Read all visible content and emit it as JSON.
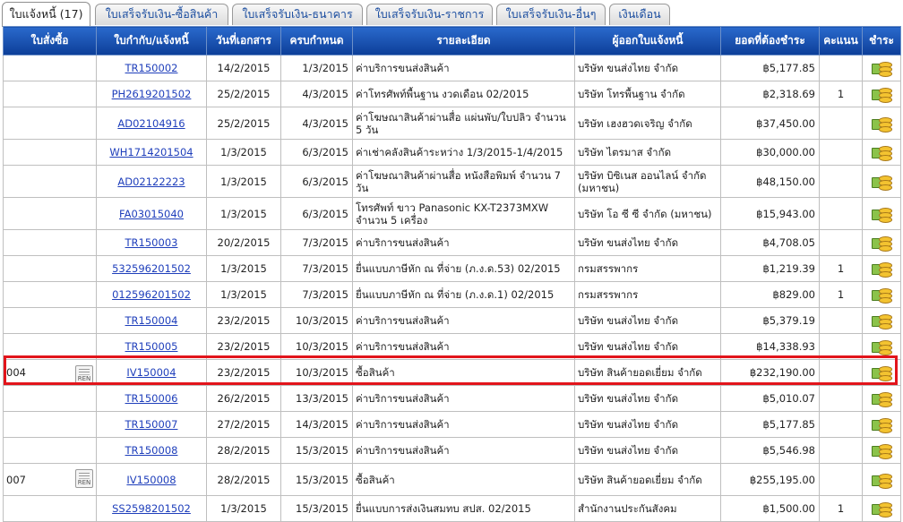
{
  "tabs": [
    {
      "label": "ใบแจ้งหนี้ (17)",
      "active": true
    },
    {
      "label": "ใบเสร็จรับเงิน-ซื้อสินค้า",
      "active": false
    },
    {
      "label": "ใบเสร็จรับเงิน-ธนาคาร",
      "active": false
    },
    {
      "label": "ใบเสร็จรับเงิน-ราชการ",
      "active": false
    },
    {
      "label": "ใบเสร็จรับเงิน-อื่นๆ",
      "active": false
    },
    {
      "label": "เงินเดือน",
      "active": false
    }
  ],
  "columns": [
    "ใบสั่งซื้อ",
    "ใบกำกับ/แจ้งหนี้",
    "วันที่เอกสาร",
    "ครบกำหนด",
    "รายละเอียด",
    "ผู้ออกใบแจ้งหนี้",
    "ยอดที่ต้องชำระ",
    "คะแนน",
    "ชำระ"
  ],
  "attachment_label": "REN",
  "pay_icon": "money-coins-icon",
  "highlight_color": "#e2141b",
  "rows": [
    {
      "order": "",
      "ref": "TR150002",
      "doc_date": "14/2/2015",
      "due": "1/3/2015",
      "detail": "ค่าบริการขนส่งสินค้า",
      "issuer": "บริษัท ขนส่งไทย จำกัด",
      "amount": "฿5,177.85",
      "score": ""
    },
    {
      "order": "",
      "ref": "PH2619201502",
      "doc_date": "25/2/2015",
      "due": "4/3/2015",
      "detail": "ค่าโทรศัพท์พื้นฐาน งวดเดือน 02/2015",
      "issuer": "บริษัท โทรพื้นฐาน จำกัด",
      "amount": "฿2,318.69",
      "score": "1"
    },
    {
      "order": "",
      "ref": "AD02104916",
      "doc_date": "25/2/2015",
      "due": "4/3/2015",
      "detail": "ค่าโฆษณาสินค้าผ่านสื่อ แผ่นพับ/ใบปลิว จำนวน 5 วัน",
      "issuer": "บริษัท เฮงฮวดเจริญ จำกัด",
      "amount": "฿37,450.00",
      "score": ""
    },
    {
      "order": "",
      "ref": "WH1714201504",
      "doc_date": "1/3/2015",
      "due": "6/3/2015",
      "detail": "ค่าเช่าคลังสินค้าระหว่าง 1/3/2015-1/4/2015",
      "issuer": "บริษัท ไตรมาส จำกัด",
      "amount": "฿30,000.00",
      "score": ""
    },
    {
      "order": "",
      "ref": "AD02122223",
      "doc_date": "1/3/2015",
      "due": "6/3/2015",
      "detail": "ค่าโฆษณาสินค้าผ่านสื่อ หนังสือพิมพ์ จำนวน 7 วัน",
      "issuer": "บริษัท บิซิเนส ออนไลน์ จำกัด (มหาชน)",
      "amount": "฿48,150.00",
      "score": ""
    },
    {
      "order": "",
      "ref": "FA03015040",
      "doc_date": "1/3/2015",
      "due": "6/3/2015",
      "detail": "โทรศัพท์ ขาว Panasonic KX-T2373MXW จำนวน 5 เครื่อง",
      "issuer": "บริษัท โอ ซี ซี จำกัด (มหาชน)",
      "amount": "฿15,943.00",
      "score": ""
    },
    {
      "order": "",
      "ref": "TR150003",
      "doc_date": "20/2/2015",
      "due": "7/3/2015",
      "detail": "ค่าบริการขนส่งสินค้า",
      "issuer": "บริษัท ขนส่งไทย จำกัด",
      "amount": "฿4,708.05",
      "score": ""
    },
    {
      "order": "",
      "ref": "532596201502",
      "doc_date": "1/3/2015",
      "due": "7/3/2015",
      "detail": "ยื่นแบบภาษีหัก ณ ที่จ่าย (ภ.ง.ด.53) 02/2015",
      "issuer": "กรมสรรพากร",
      "amount": "฿1,219.39",
      "score": "1"
    },
    {
      "order": "",
      "ref": "012596201502",
      "doc_date": "1/3/2015",
      "due": "7/3/2015",
      "detail": "ยื่นแบบภาษีหัก ณ ที่จ่าย (ภ.ง.ด.1) 02/2015",
      "issuer": "กรมสรรพากร",
      "amount": "฿829.00",
      "score": "1"
    },
    {
      "order": "",
      "ref": "TR150004",
      "doc_date": "23/2/2015",
      "due": "10/3/2015",
      "detail": "ค่าบริการขนส่งสินค้า",
      "issuer": "บริษัท ขนส่งไทย จำกัด",
      "amount": "฿5,379.19",
      "score": ""
    },
    {
      "order": "",
      "ref": "TR150005",
      "doc_date": "23/2/2015",
      "due": "10/3/2015",
      "detail": "ค่าบริการขนส่งสินค้า",
      "issuer": "บริษัท ขนส่งไทย จำกัด",
      "amount": "฿14,338.93",
      "score": ""
    },
    {
      "order": "004",
      "ref": "IV150004",
      "doc_date": "23/2/2015",
      "due": "10/3/2015",
      "detail": "ซื้อสินค้า",
      "issuer": "บริษัท สินค้ายอดเยี่ยม จำกัด",
      "amount": "฿232,190.00",
      "score": "",
      "highlighted": true
    },
    {
      "order": "",
      "ref": "TR150006",
      "doc_date": "26/2/2015",
      "due": "13/3/2015",
      "detail": "ค่าบริการขนส่งสินค้า",
      "issuer": "บริษัท ขนส่งไทย จำกัด",
      "amount": "฿5,010.07",
      "score": ""
    },
    {
      "order": "",
      "ref": "TR150007",
      "doc_date": "27/2/2015",
      "due": "14/3/2015",
      "detail": "ค่าบริการขนส่งสินค้า",
      "issuer": "บริษัท ขนส่งไทย จำกัด",
      "amount": "฿5,177.85",
      "score": ""
    },
    {
      "order": "",
      "ref": "TR150008",
      "doc_date": "28/2/2015",
      "due": "15/3/2015",
      "detail": "ค่าบริการขนส่งสินค้า",
      "issuer": "บริษัท ขนส่งไทย จำกัด",
      "amount": "฿5,546.98",
      "score": ""
    },
    {
      "order": "007",
      "ref": "IV150008",
      "doc_date": "28/2/2015",
      "due": "15/3/2015",
      "detail": "ซื้อสินค้า",
      "issuer": "บริษัท สินค้ายอดเยี่ยม จำกัด",
      "amount": "฿255,195.00",
      "score": ""
    },
    {
      "order": "",
      "ref": "SS2598201502",
      "doc_date": "1/3/2015",
      "due": "15/3/2015",
      "detail": "ยื่นแบบการส่งเงินสมทบ สปส. 02/2015",
      "issuer": "สำนักงานประกันสังคม",
      "amount": "฿1,500.00",
      "score": "1"
    }
  ]
}
